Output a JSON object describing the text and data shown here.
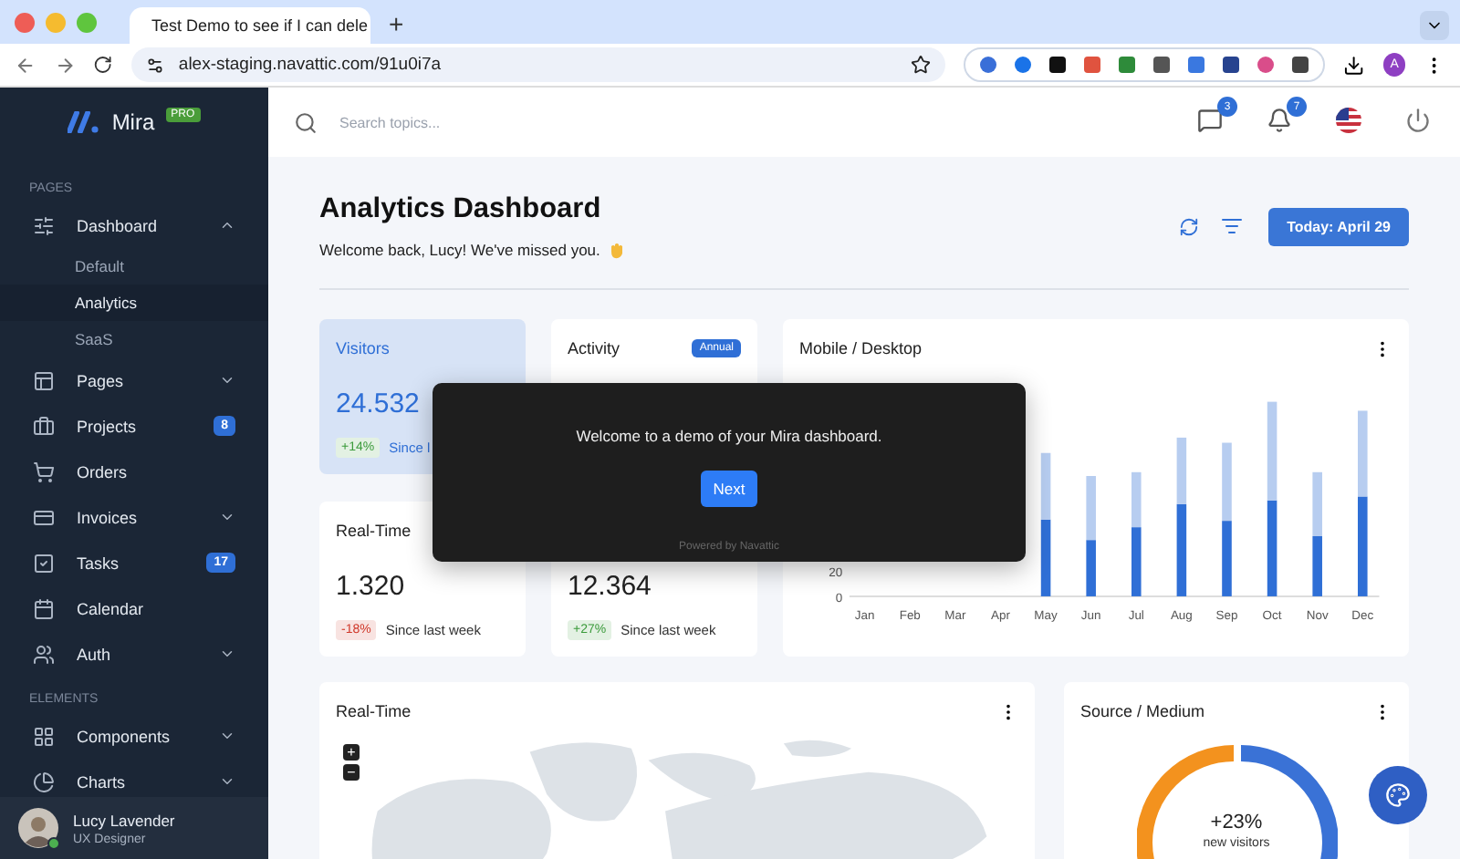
{
  "browser": {
    "tab_title": "Test Demo to see if I can dele",
    "new_tab": "+",
    "url": "alex-staging.navattic.com/91u0i7a",
    "profile_initial": "A"
  },
  "sidebar": {
    "brand": "Mira",
    "brand_badge": "PRO",
    "sections": [
      {
        "heading": "PAGES",
        "items": [
          {
            "label": "Dashboard",
            "expandable": true,
            "expanded": true,
            "children": [
              {
                "label": "Default",
                "selected": false
              },
              {
                "label": "Analytics",
                "selected": true
              },
              {
                "label": "SaaS",
                "selected": false
              }
            ]
          },
          {
            "label": "Pages",
            "expandable": true,
            "expanded": false
          },
          {
            "label": "Projects",
            "expandable": false,
            "badge": "8"
          },
          {
            "label": "Orders",
            "expandable": false
          },
          {
            "label": "Invoices",
            "expandable": true,
            "expanded": false
          },
          {
            "label": "Tasks",
            "expandable": false,
            "badge": "17"
          },
          {
            "label": "Calendar",
            "expandable": false
          },
          {
            "label": "Auth",
            "expandable": true,
            "expanded": false
          }
        ]
      },
      {
        "heading": "ELEMENTS",
        "items": [
          {
            "label": "Components",
            "expandable": true,
            "expanded": false
          },
          {
            "label": "Charts",
            "expandable": true,
            "expanded": false
          }
        ]
      }
    ],
    "user": {
      "name": "Lucy Lavender",
      "role": "UX Designer",
      "online": true
    }
  },
  "header": {
    "search": {
      "placeholder": "Search topics..."
    },
    "messages_badge": "3",
    "notifications_badge": "7"
  },
  "page": {
    "title": "Analytics Dashboard",
    "welcome": "Welcome back, Lucy! We've missed you.",
    "date_button": "Today: April 29"
  },
  "stats": [
    {
      "title": "Visitors",
      "highlighted": true,
      "value": "24.532",
      "change": "+14%",
      "color": "#3a9a3a",
      "note": "Since l"
    },
    {
      "title": "Activity",
      "highlighted": false,
      "tag": "Annual"
    },
    {
      "title": "Real-Time",
      "highlighted": false,
      "value": "1.320",
      "change": "-18%",
      "color": "#d0392b",
      "note": "Since last week"
    },
    {
      "highlighted": false,
      "value": "12.364",
      "change": "+27%",
      "color": "#3a9a3a",
      "note": "Since last week"
    }
  ],
  "bar_card": {
    "title": "Mobile / Desktop",
    "chart_data": {
      "type": "bar",
      "stacked": true,
      "categories": [
        "Jan",
        "Feb",
        "Mar",
        "Apr",
        "May",
        "Jun",
        "Jul",
        "Aug",
        "Sep",
        "Oct",
        "Nov",
        "Dec"
      ],
      "ylim": [
        0,
        160
      ],
      "yticks": [
        0,
        20
      ],
      "series": [
        {
          "color": "#2f6fd6",
          "values": [
            null,
            null,
            null,
            null,
            60,
            44,
            54,
            72,
            59,
            75,
            47,
            78
          ]
        },
        {
          "color": "#b7cdf0",
          "values": [
            null,
            null,
            null,
            null,
            52,
            50,
            43,
            52,
            61,
            77,
            50,
            67
          ]
        }
      ]
    }
  },
  "map_card": {
    "title": "Real-Time",
    "zoom_in": "+",
    "zoom_out": "−"
  },
  "source_card": {
    "title": "Source / Medium",
    "center_value": "+23%",
    "center_label": "new visitors"
  },
  "modal": {
    "message": "Welcome to a demo of your Mira dashboard.",
    "button": "Next",
    "footer": "Powered by Navattic"
  }
}
